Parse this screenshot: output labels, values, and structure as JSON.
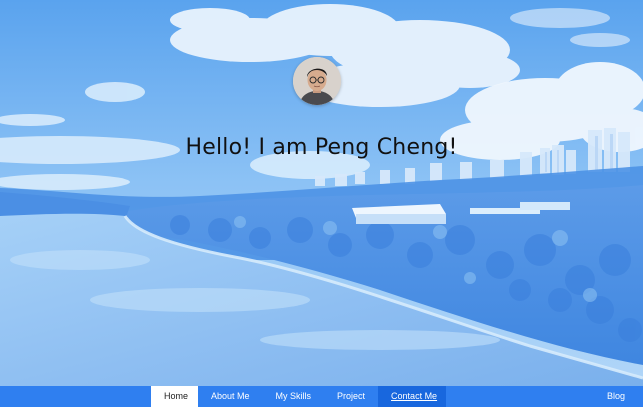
{
  "hero": {
    "title": "Hello! I am Peng Cheng!"
  },
  "nav": {
    "items": [
      {
        "label": "Home",
        "active": true
      },
      {
        "label": "About Me"
      },
      {
        "label": "My Skills"
      },
      {
        "label": "Project"
      },
      {
        "label": "Contact Me",
        "highlighted": true
      }
    ],
    "blog_label": "Blog"
  },
  "colors": {
    "nav_background": "#2f7ff0",
    "nav_highlight": "#1867de",
    "sky_tint": "#8cc0f4",
    "river": "#a9d2f6"
  }
}
